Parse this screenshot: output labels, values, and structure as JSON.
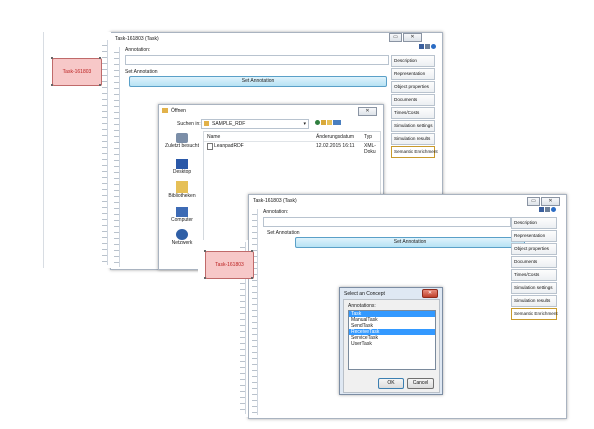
{
  "back_window": {
    "title": "Task-161803 (Task)",
    "annotation_label": "Annotation:",
    "set_annotation_label": "Set Annotation",
    "set_annotation_button": "Set Annotation",
    "tabs": [
      "Description",
      "Representation",
      "Object properties",
      "Documents",
      "Times/Costs",
      "Simulation settings",
      "Simulation results",
      "Semantic Enrichment"
    ],
    "active_tab": "Semantic Enrichment"
  },
  "back_node": {
    "label": "Task-161803"
  },
  "open_dialog": {
    "title": "Öffnen",
    "look_in_label": "Suchen in:",
    "look_in_value": "SAMPLE_RDF",
    "columns": [
      "Name",
      "Änderungsdatum",
      "Typ"
    ],
    "files": [
      {
        "name": "LeanpadRDF",
        "date": "12.02.2015 16:11",
        "type": "XML-Doku"
      }
    ],
    "places": [
      "Zuletzt besucht",
      "Desktop",
      "Bibliotheken",
      "Computer",
      "Netzwerk"
    ]
  },
  "front_window": {
    "title": "Task-161803 (Task)",
    "annotation_label": "Annotation:",
    "set_annotation_label": "Set Annotation",
    "set_annotation_button": "Set Annotation",
    "tabs": [
      "Description",
      "Representation",
      "Object properties",
      "Documents",
      "Times/Costs",
      "Simulation settings",
      "Simulation results",
      "Semantic Enrichment"
    ],
    "active_tab": "Semantic Enrichment"
  },
  "front_node": {
    "label": "Task-161803"
  },
  "concept_dialog": {
    "title": "Select an Concept",
    "annotations_label": "Annotations:",
    "options": [
      "Task",
      "ManualTask",
      "SendTask",
      "ReceiveTask",
      "ServiceTask",
      "UserTask"
    ],
    "selected": [
      "Task",
      "ReceiveTask"
    ],
    "ok_label": "OK",
    "cancel_label": "Cancel"
  },
  "colors": {
    "selection": "#3399ff",
    "node_fill": "#f7c8c8",
    "node_text": "#b22222",
    "button_blue": "#b7e2f4"
  }
}
